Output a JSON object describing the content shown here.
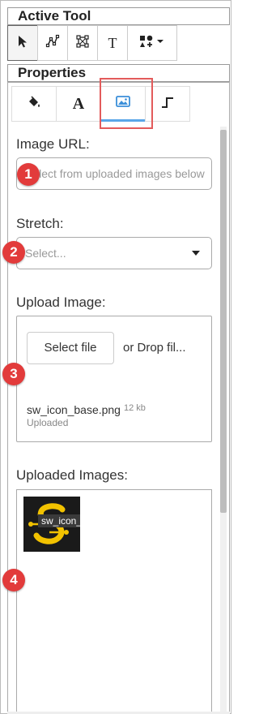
{
  "active_tool": {
    "title": "Active Tool",
    "tools": [
      {
        "name": "select-tool",
        "icon": "cursor-arrow-icon",
        "active": true
      },
      {
        "name": "path-tool",
        "icon": "node-path-icon",
        "active": false
      },
      {
        "name": "transform-tool",
        "icon": "bounding-box-icon",
        "active": false
      },
      {
        "name": "text-tool",
        "icon": "text-t-icon",
        "active": false
      },
      {
        "name": "shapes-tool",
        "icon": "shapes-add-icon",
        "active": false
      }
    ]
  },
  "properties": {
    "title": "Properties",
    "tabs": [
      {
        "name": "fill",
        "icon": "paint-bucket-icon",
        "active": false
      },
      {
        "name": "text",
        "icon": "letter-a-icon",
        "active": false
      },
      {
        "name": "image",
        "icon": "image-icon",
        "active": true
      },
      {
        "name": "line",
        "icon": "step-line-icon",
        "active": false
      }
    ],
    "image_url": {
      "label": "Image URL:",
      "placeholder": "Select from uploaded images below"
    },
    "stretch": {
      "label": "Stretch:",
      "placeholder": "Select..."
    },
    "upload": {
      "label": "Upload Image:",
      "select_button": "Select file",
      "drop_text": "or Drop fil...",
      "file_name": "sw_icon_base.png",
      "file_size": "12 kb",
      "file_status": "Uploaded"
    },
    "uploaded_images": {
      "label": "Uploaded Images:",
      "items": [
        {
          "caption": "sw_icon_base"
        }
      ]
    }
  },
  "annotations": {
    "badge_1": "1",
    "badge_2": "2",
    "badge_3": "3",
    "badge_4": "4"
  },
  "colors": {
    "accent_tab": "#5aa6e8",
    "highlight": "#e35b5b",
    "badge": "#e23b3b",
    "thumb_icon": "#f2c200"
  }
}
